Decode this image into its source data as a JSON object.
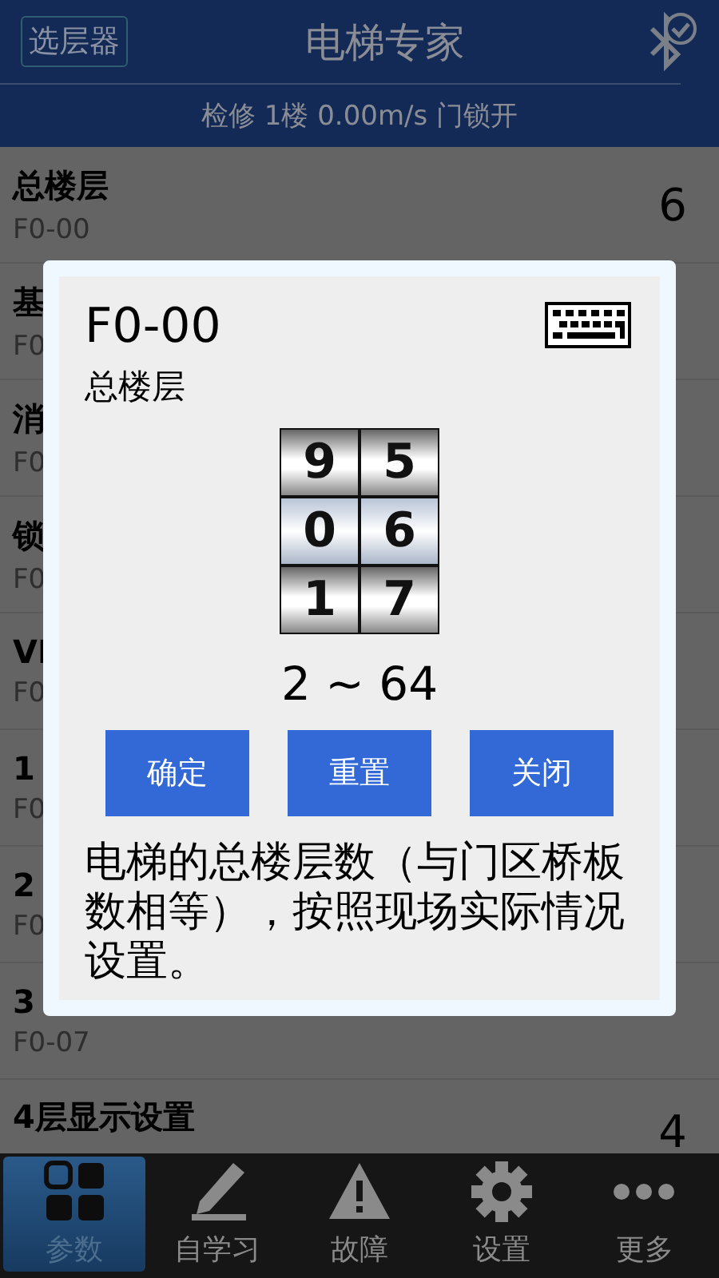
{
  "header": {
    "selector_button": "选层器",
    "title": "电梯专家",
    "status": "检修 1楼 0.00m/s 门锁开"
  },
  "parameters": [
    {
      "name": "总楼层",
      "code": "F0-00",
      "value": "6"
    },
    {
      "name": "基",
      "code": "F0"
    },
    {
      "name": "消",
      "code": "F0"
    },
    {
      "name": "锁",
      "code": "F0"
    },
    {
      "name": "VI",
      "code": "F0"
    },
    {
      "name": "1",
      "code": "F0"
    },
    {
      "name": "2",
      "code": "F0"
    },
    {
      "name": "3",
      "code": "F0-07"
    },
    {
      "name": "4层显示设置",
      "value": "4"
    }
  ],
  "dialog": {
    "code": "F0-00",
    "name": "总楼层",
    "picker": [
      {
        "digits": [
          "9",
          "0",
          "1"
        ]
      },
      {
        "digits": [
          "5",
          "6",
          "7"
        ]
      }
    ],
    "range": "2 ~ 64",
    "buttons": [
      "确定",
      "重置",
      "关闭"
    ],
    "description": "电梯的总楼层数（与门区桥板数相等），按照现场实际情况设置。"
  },
  "tabs": [
    {
      "kind": "grid",
      "label": "参数",
      "selected": true
    },
    {
      "kind": "pencil",
      "label": "自学习",
      "selected": false
    },
    {
      "kind": "warning",
      "label": "故障",
      "selected": false
    },
    {
      "kind": "gear",
      "label": "设置",
      "selected": false
    },
    {
      "kind": "dots",
      "label": "更多",
      "selected": false
    }
  ]
}
